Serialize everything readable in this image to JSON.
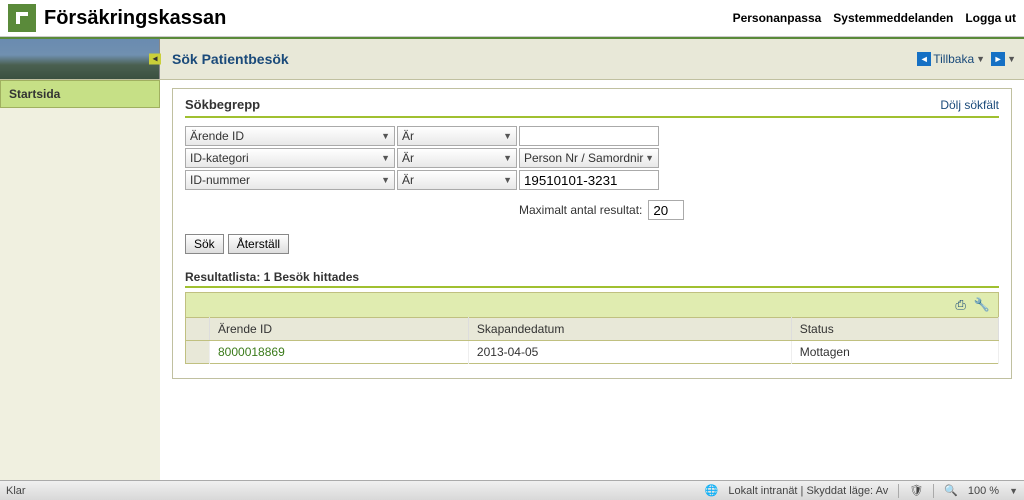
{
  "header": {
    "brand": "Försäkringskassan",
    "links": {
      "personalize": "Personanpassa",
      "messages": "Systemmeddelanden",
      "logout": "Logga ut"
    }
  },
  "titlebar": {
    "title": "Sök Patientbesök",
    "back": "Tillbaka"
  },
  "sidebar": {
    "home": "Startsida"
  },
  "search": {
    "heading": "Sökbegrepp",
    "hide_link": "Dölj sökfält",
    "rows": [
      {
        "label": "Ärende ID",
        "op": "Är",
        "value": "",
        "value_type": "input"
      },
      {
        "label": "ID-kategori",
        "op": "Är",
        "value": "Person Nr / Samordnir",
        "value_type": "combo"
      },
      {
        "label": "ID-nummer",
        "op": "Är",
        "value": "19510101-3231",
        "value_type": "input"
      }
    ],
    "max_label": "Maximalt antal resultat:",
    "max_value": "20",
    "search_btn": "Sök",
    "reset_btn": "Återställ"
  },
  "results": {
    "title": "Resultatlista: 1 Besök hittades",
    "columns": {
      "id": "Ärende ID",
      "created": "Skapandedatum",
      "status": "Status"
    },
    "rows": [
      {
        "id": "8000018869",
        "created": "2013-04-05",
        "status": "Mottagen"
      }
    ]
  },
  "statusbar": {
    "left": "Klar",
    "zone": "Lokalt intranät | Skyddat läge: Av",
    "zoom": "100 %"
  }
}
